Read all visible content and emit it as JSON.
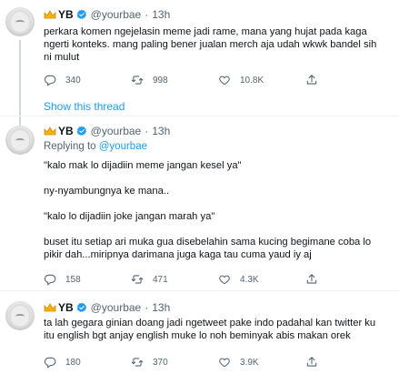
{
  "tweets": [
    {
      "name": "YB",
      "handle": "@yourbae",
      "dot": "·",
      "time": "13h",
      "lines": [
        "perkara komen ngejelasin meme jadi rame, mana yang hujat pada kaga",
        "ngerti konteks. mang paling bener jualan merch aja udah wkwk bandel sih",
        "ni mulut"
      ],
      "replies": "340",
      "retweets": "998",
      "likes": "10.8K"
    },
    {
      "name": "YB",
      "handle": "@yourbae",
      "dot": "·",
      "time": "13h",
      "replying_label": "Replying to",
      "replying_handle": "@yourbae",
      "lines": [
        "\"kalo mak lo dijadiin meme jangan kesel ya\"",
        "",
        "ny-nyambungnya ke mana..",
        "",
        "\"kalo lo dijadiin joke jangan marah ya\"",
        "",
        "buset itu setiap ari muka gua disebelahin sama kucing begimane coba lo",
        "pikir dah...miripnya darimana juga kaga tau cuma yaud iy aj"
      ],
      "replies": "158",
      "retweets": "471",
      "likes": "4.3K"
    },
    {
      "name": "YB",
      "handle": "@yourbae",
      "dot": "·",
      "time": "13h",
      "lines": [
        "ta  lah gegara ginian doang jadi ngetweet pake indo padahal kan twitter ku",
        "itu english bgt anjay english muke lo noh beminyak abis makan orek"
      ],
      "replies": "180",
      "retweets": "370",
      "likes": "3.9K"
    }
  ],
  "show_thread": "Show this thread",
  "colors": {
    "text": "#0f1419",
    "muted": "#536471",
    "link": "#1d9bf0",
    "divider": "#eff3f4"
  }
}
